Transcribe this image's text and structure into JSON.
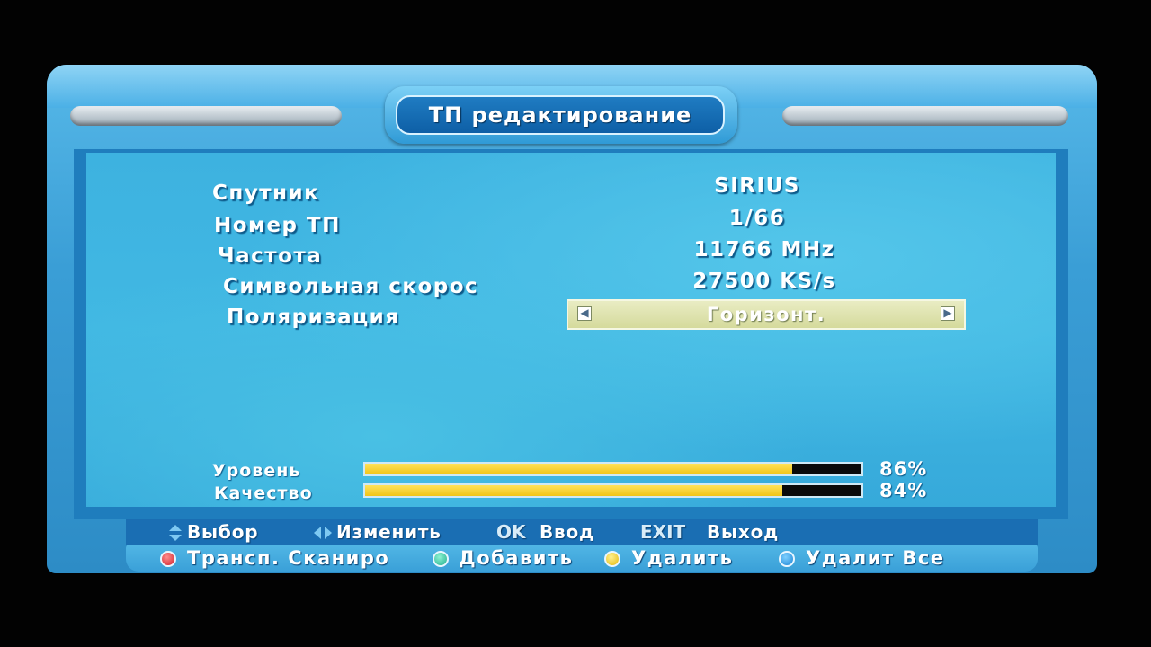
{
  "title": "ТП редактирование",
  "fields": [
    {
      "label": "Спутник",
      "value": "SIRIUS"
    },
    {
      "label": "Номер ТП",
      "value": "1/66"
    },
    {
      "label": "Частота",
      "value": "11766 MHz"
    },
    {
      "label": "Символьная скорос",
      "value": "27500 KS/s"
    }
  ],
  "polarization": {
    "label": "Поляризация",
    "value": "Горизонт."
  },
  "signal": {
    "level_label": "Уровень",
    "level_pct": "86%",
    "level_value": 86,
    "quality_label": "Качество",
    "quality_pct": "84%",
    "quality_value": 84,
    "fill_color": "#f1c417"
  },
  "help_row1": {
    "select": "Выбор",
    "change": "Изменить",
    "ok_key": "OK",
    "ok_label": "Ввод",
    "exit_key": "EXIT",
    "exit_label": "Выход"
  },
  "help_row2": {
    "red": "Трансп. Сканиро",
    "green": "Добавить",
    "yellow": "Удалить",
    "blue": "Удалит Все"
  },
  "colors": {
    "frame": "#3a9ed6",
    "content_bg": "#3db2e0",
    "title_bg": "#0e5fa6",
    "selector_bg": "#d5da9c"
  }
}
